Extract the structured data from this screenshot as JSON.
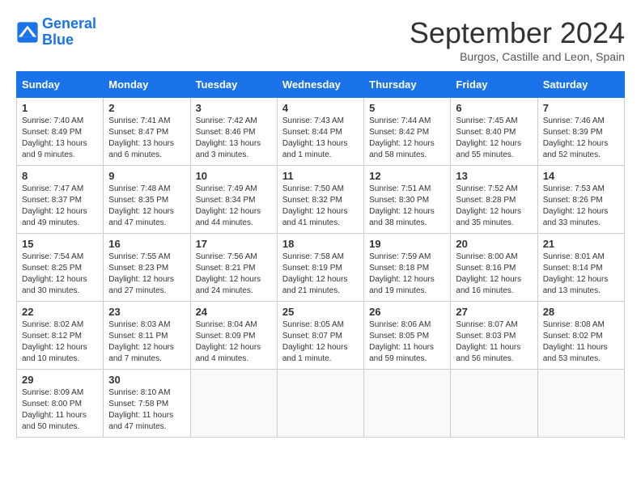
{
  "header": {
    "logo_line1": "General",
    "logo_line2": "Blue",
    "month": "September 2024",
    "location": "Burgos, Castille and Leon, Spain"
  },
  "days_of_week": [
    "Sunday",
    "Monday",
    "Tuesday",
    "Wednesday",
    "Thursday",
    "Friday",
    "Saturday"
  ],
  "weeks": [
    [
      {
        "day": "1",
        "info": "Sunrise: 7:40 AM\nSunset: 8:49 PM\nDaylight: 13 hours and 9 minutes."
      },
      {
        "day": "2",
        "info": "Sunrise: 7:41 AM\nSunset: 8:47 PM\nDaylight: 13 hours and 6 minutes."
      },
      {
        "day": "3",
        "info": "Sunrise: 7:42 AM\nSunset: 8:46 PM\nDaylight: 13 hours and 3 minutes."
      },
      {
        "day": "4",
        "info": "Sunrise: 7:43 AM\nSunset: 8:44 PM\nDaylight: 13 hours and 1 minute."
      },
      {
        "day": "5",
        "info": "Sunrise: 7:44 AM\nSunset: 8:42 PM\nDaylight: 12 hours and 58 minutes."
      },
      {
        "day": "6",
        "info": "Sunrise: 7:45 AM\nSunset: 8:40 PM\nDaylight: 12 hours and 55 minutes."
      },
      {
        "day": "7",
        "info": "Sunrise: 7:46 AM\nSunset: 8:39 PM\nDaylight: 12 hours and 52 minutes."
      }
    ],
    [
      {
        "day": "8",
        "info": "Sunrise: 7:47 AM\nSunset: 8:37 PM\nDaylight: 12 hours and 49 minutes."
      },
      {
        "day": "9",
        "info": "Sunrise: 7:48 AM\nSunset: 8:35 PM\nDaylight: 12 hours and 47 minutes."
      },
      {
        "day": "10",
        "info": "Sunrise: 7:49 AM\nSunset: 8:34 PM\nDaylight: 12 hours and 44 minutes."
      },
      {
        "day": "11",
        "info": "Sunrise: 7:50 AM\nSunset: 8:32 PM\nDaylight: 12 hours and 41 minutes."
      },
      {
        "day": "12",
        "info": "Sunrise: 7:51 AM\nSunset: 8:30 PM\nDaylight: 12 hours and 38 minutes."
      },
      {
        "day": "13",
        "info": "Sunrise: 7:52 AM\nSunset: 8:28 PM\nDaylight: 12 hours and 35 minutes."
      },
      {
        "day": "14",
        "info": "Sunrise: 7:53 AM\nSunset: 8:26 PM\nDaylight: 12 hours and 33 minutes."
      }
    ],
    [
      {
        "day": "15",
        "info": "Sunrise: 7:54 AM\nSunset: 8:25 PM\nDaylight: 12 hours and 30 minutes."
      },
      {
        "day": "16",
        "info": "Sunrise: 7:55 AM\nSunset: 8:23 PM\nDaylight: 12 hours and 27 minutes."
      },
      {
        "day": "17",
        "info": "Sunrise: 7:56 AM\nSunset: 8:21 PM\nDaylight: 12 hours and 24 minutes."
      },
      {
        "day": "18",
        "info": "Sunrise: 7:58 AM\nSunset: 8:19 PM\nDaylight: 12 hours and 21 minutes."
      },
      {
        "day": "19",
        "info": "Sunrise: 7:59 AM\nSunset: 8:18 PM\nDaylight: 12 hours and 19 minutes."
      },
      {
        "day": "20",
        "info": "Sunrise: 8:00 AM\nSunset: 8:16 PM\nDaylight: 12 hours and 16 minutes."
      },
      {
        "day": "21",
        "info": "Sunrise: 8:01 AM\nSunset: 8:14 PM\nDaylight: 12 hours and 13 minutes."
      }
    ],
    [
      {
        "day": "22",
        "info": "Sunrise: 8:02 AM\nSunset: 8:12 PM\nDaylight: 12 hours and 10 minutes."
      },
      {
        "day": "23",
        "info": "Sunrise: 8:03 AM\nSunset: 8:11 PM\nDaylight: 12 hours and 7 minutes."
      },
      {
        "day": "24",
        "info": "Sunrise: 8:04 AM\nSunset: 8:09 PM\nDaylight: 12 hours and 4 minutes."
      },
      {
        "day": "25",
        "info": "Sunrise: 8:05 AM\nSunset: 8:07 PM\nDaylight: 12 hours and 1 minute."
      },
      {
        "day": "26",
        "info": "Sunrise: 8:06 AM\nSunset: 8:05 PM\nDaylight: 11 hours and 59 minutes."
      },
      {
        "day": "27",
        "info": "Sunrise: 8:07 AM\nSunset: 8:03 PM\nDaylight: 11 hours and 56 minutes."
      },
      {
        "day": "28",
        "info": "Sunrise: 8:08 AM\nSunset: 8:02 PM\nDaylight: 11 hours and 53 minutes."
      }
    ],
    [
      {
        "day": "29",
        "info": "Sunrise: 8:09 AM\nSunset: 8:00 PM\nDaylight: 11 hours and 50 minutes."
      },
      {
        "day": "30",
        "info": "Sunrise: 8:10 AM\nSunset: 7:58 PM\nDaylight: 11 hours and 47 minutes."
      },
      {
        "day": "",
        "info": ""
      },
      {
        "day": "",
        "info": ""
      },
      {
        "day": "",
        "info": ""
      },
      {
        "day": "",
        "info": ""
      },
      {
        "day": "",
        "info": ""
      }
    ]
  ]
}
